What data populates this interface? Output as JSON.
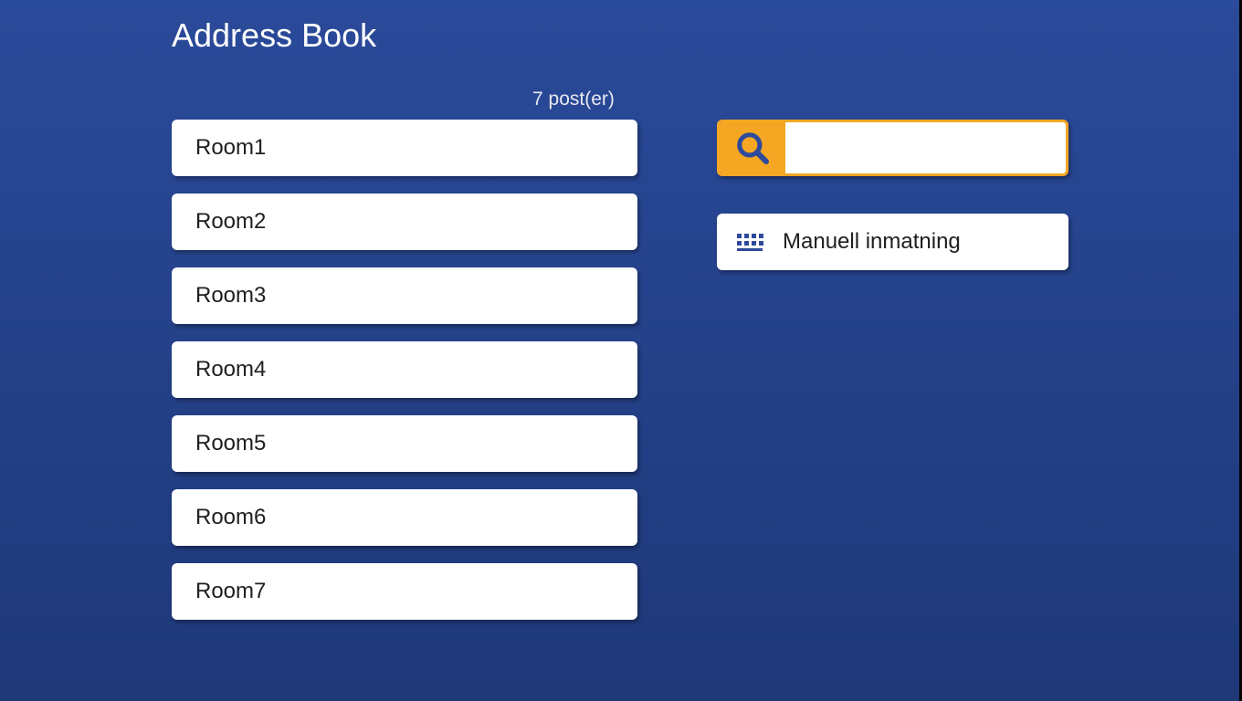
{
  "header": {
    "title": "Address Book"
  },
  "entryCount": "7 post(er)",
  "entries": [
    {
      "name": "Room1"
    },
    {
      "name": "Room2"
    },
    {
      "name": "Room3"
    },
    {
      "name": "Room4"
    },
    {
      "name": "Room5"
    },
    {
      "name": "Room6"
    },
    {
      "name": "Room7"
    }
  ],
  "search": {
    "value": ""
  },
  "manual": {
    "label": "Manuell inmatning"
  }
}
